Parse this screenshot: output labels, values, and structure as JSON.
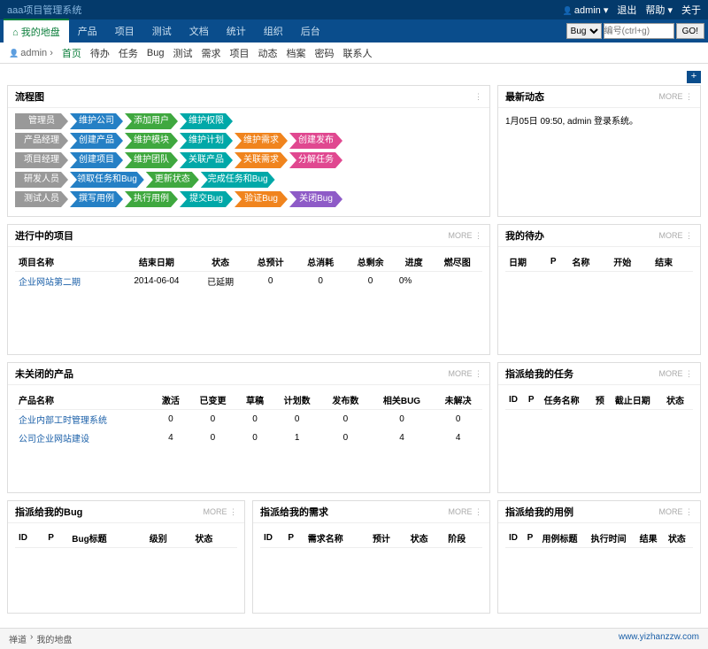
{
  "header": {
    "system_title": "aaa项目管理系统",
    "user": "admin",
    "logout": "退出",
    "help": "帮助",
    "about": "关于"
  },
  "nav": {
    "tabs": [
      "我的地盘",
      "产品",
      "项目",
      "测试",
      "文档",
      "统计",
      "组织",
      "后台"
    ],
    "search_type": "Bug",
    "search_placeholder": "编号(ctrl+g)",
    "go": "GO!"
  },
  "subnav": {
    "user": "admin",
    "items": [
      "首页",
      "待办",
      "任务",
      "Bug",
      "测试",
      "需求",
      "项目",
      "动态",
      "档案",
      "密码",
      "联系人"
    ]
  },
  "flow": {
    "title": "流程图",
    "rows": [
      {
        "role": "管理员",
        "steps": [
          {
            "t": "维护公司",
            "c": "c-blue"
          },
          {
            "t": "添加用户",
            "c": "c-green"
          },
          {
            "t": "维护权限",
            "c": "c-teal"
          }
        ]
      },
      {
        "role": "产品经理",
        "steps": [
          {
            "t": "创建产品",
            "c": "c-blue"
          },
          {
            "t": "维护模块",
            "c": "c-green"
          },
          {
            "t": "维护计划",
            "c": "c-teal"
          },
          {
            "t": "维护需求",
            "c": "c-orange"
          },
          {
            "t": "创建发布",
            "c": "c-pink"
          }
        ]
      },
      {
        "role": "项目经理",
        "steps": [
          {
            "t": "创建项目",
            "c": "c-blue"
          },
          {
            "t": "维护团队",
            "c": "c-green"
          },
          {
            "t": "关联产品",
            "c": "c-teal"
          },
          {
            "t": "关联需求",
            "c": "c-orange"
          },
          {
            "t": "分解任务",
            "c": "c-pink"
          }
        ]
      },
      {
        "role": "研发人员",
        "steps": [
          {
            "t": "领取任务和Bug",
            "c": "c-blue"
          },
          {
            "t": "更新状态",
            "c": "c-green"
          },
          {
            "t": "完成任务和Bug",
            "c": "c-teal"
          }
        ]
      },
      {
        "role": "测试人员",
        "steps": [
          {
            "t": "撰写用例",
            "c": "c-blue"
          },
          {
            "t": "执行用例",
            "c": "c-green"
          },
          {
            "t": "提交Bug",
            "c": "c-teal"
          },
          {
            "t": "验证Bug",
            "c": "c-orange"
          },
          {
            "t": "关闭Bug",
            "c": "c-purple"
          }
        ]
      }
    ]
  },
  "dynamics": {
    "title": "最新动态",
    "text": "1月05日 09:50, admin 登录系统。"
  },
  "projects": {
    "title": "进行中的项目",
    "cols": [
      "项目名称",
      "结束日期",
      "状态",
      "总预计",
      "总消耗",
      "总剩余",
      "进度",
      "燃尽图"
    ],
    "rows": [
      {
        "name": "企业网站第二期",
        "end": "2014-06-04",
        "status": "已延期",
        "est": "0",
        "used": "0",
        "left": "0",
        "prog": "0%"
      }
    ]
  },
  "todo": {
    "title": "我的待办",
    "cols": [
      "日期",
      "P",
      "名称",
      "开始",
      "结束"
    ]
  },
  "products": {
    "title": "未关闭的产品",
    "cols": [
      "产品名称",
      "激活",
      "已变更",
      "草稿",
      "计划数",
      "发布数",
      "相关BUG",
      "未解决"
    ],
    "rows": [
      {
        "name": "企业内部工时管理系统",
        "v": [
          "0",
          "0",
          "0",
          "0",
          "0",
          "0",
          "0"
        ]
      },
      {
        "name": "公司企业网站建设",
        "v": [
          "4",
          "0",
          "0",
          "1",
          "0",
          "4",
          "4"
        ]
      }
    ]
  },
  "mytasks": {
    "title": "指派给我的任务",
    "cols": [
      "ID",
      "P",
      "任务名称",
      "预",
      "截止日期",
      "状态"
    ]
  },
  "mybugs": {
    "title": "指派给我的Bug",
    "cols": [
      "ID",
      "P",
      "Bug标题",
      "级别",
      "状态"
    ]
  },
  "myreqs": {
    "title": "指派给我的需求",
    "cols": [
      "ID",
      "P",
      "需求名称",
      "预计",
      "状态",
      "阶段"
    ]
  },
  "mycases": {
    "title": "指派给我的用例",
    "cols": [
      "ID",
      "P",
      "用例标题",
      "执行时间",
      "结果",
      "状态"
    ]
  },
  "more": "MORE",
  "footer": {
    "left": "禅道",
    "mid": "我的地盘",
    "right": "www.yizhanzzw.com"
  }
}
